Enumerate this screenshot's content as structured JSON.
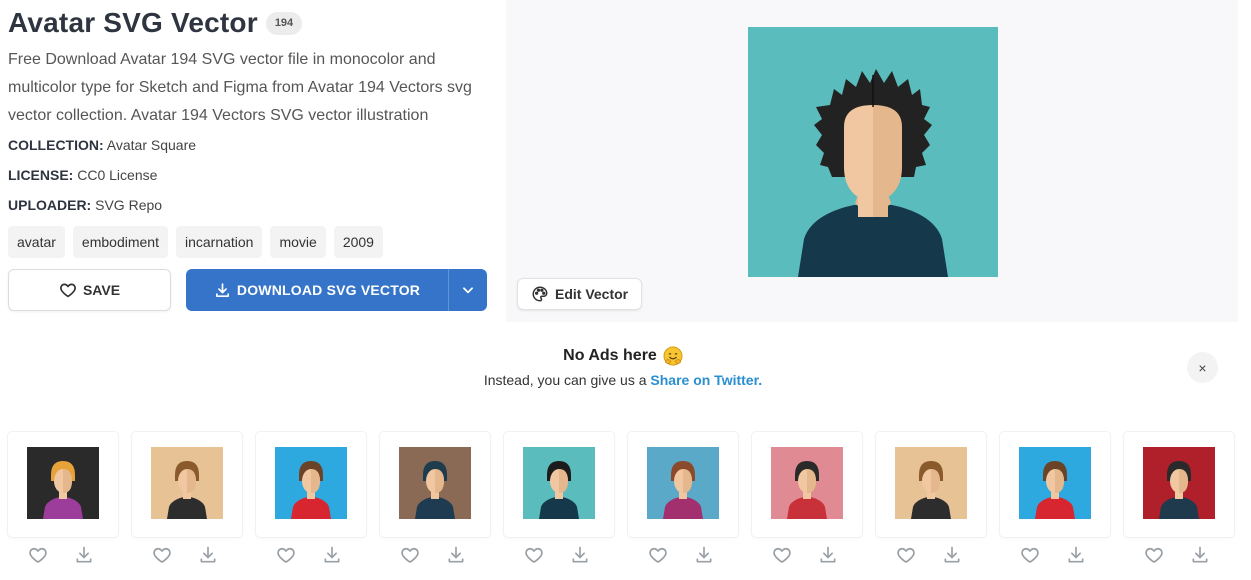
{
  "header": {
    "title": "Avatar SVG Vector",
    "count": "194",
    "description": "Free Download Avatar 194 SVG vector file in monocolor and multicolor type for Sketch and Figma from Avatar 194 Vectors svg vector collection. Avatar 194 Vectors SVG vector illustration"
  },
  "meta": {
    "collection_label": "COLLECTION:",
    "collection_value": "Avatar Square",
    "license_label": "LICENSE:",
    "license_value": "CC0 License",
    "uploader_label": "UPLOADER:",
    "uploader_value": "SVG Repo"
  },
  "tags": [
    "avatar",
    "embodiment",
    "incarnation",
    "movie",
    "2009"
  ],
  "actions": {
    "save_label": "SAVE",
    "download_label": "DOWNLOAD SVG VECTOR"
  },
  "preview": {
    "edit_label": "Edit Vector",
    "bg_color": "#5bbcbd"
  },
  "notice": {
    "title": "No Ads here",
    "emoji": "🤗",
    "text": "Instead, you can give us a",
    "link": "Share on Twitter.",
    "close": "×"
  },
  "colors": {
    "accent": "#3574c8",
    "link": "#2a8fd0"
  },
  "related": [
    {
      "bg": "#2a2a2a",
      "hair": "#e8a23a",
      "shirt": "#9c3d9c"
    },
    {
      "bg": "#e6c295",
      "hair": "#8a5a2c",
      "shirt": "#2d2d2d"
    },
    {
      "bg": "#2ea9e0",
      "hair": "#6b4428",
      "shirt": "#d7262f"
    },
    {
      "bg": "#8a6a55",
      "hair": "#1e3c4c",
      "shirt": "#1e3b52"
    },
    {
      "bg": "#5bbcbd",
      "hair": "#1c1c1c",
      "shirt": "#15384a"
    },
    {
      "bg": "#5ba9c9",
      "hair": "#8b4a2b",
      "shirt": "#a2306e"
    },
    {
      "bg": "#e08a94",
      "hair": "#2a2a2a",
      "shirt": "#c8303a"
    },
    {
      "bg": "#e6c295",
      "hair": "#8a5a2c",
      "shirt": "#2d2d2d"
    },
    {
      "bg": "#2ea9e0",
      "hair": "#6b4428",
      "shirt": "#d7262f"
    },
    {
      "bg": "#b0202a",
      "hair": "#2a2a2a",
      "shirt": "#1f3a4c"
    }
  ]
}
